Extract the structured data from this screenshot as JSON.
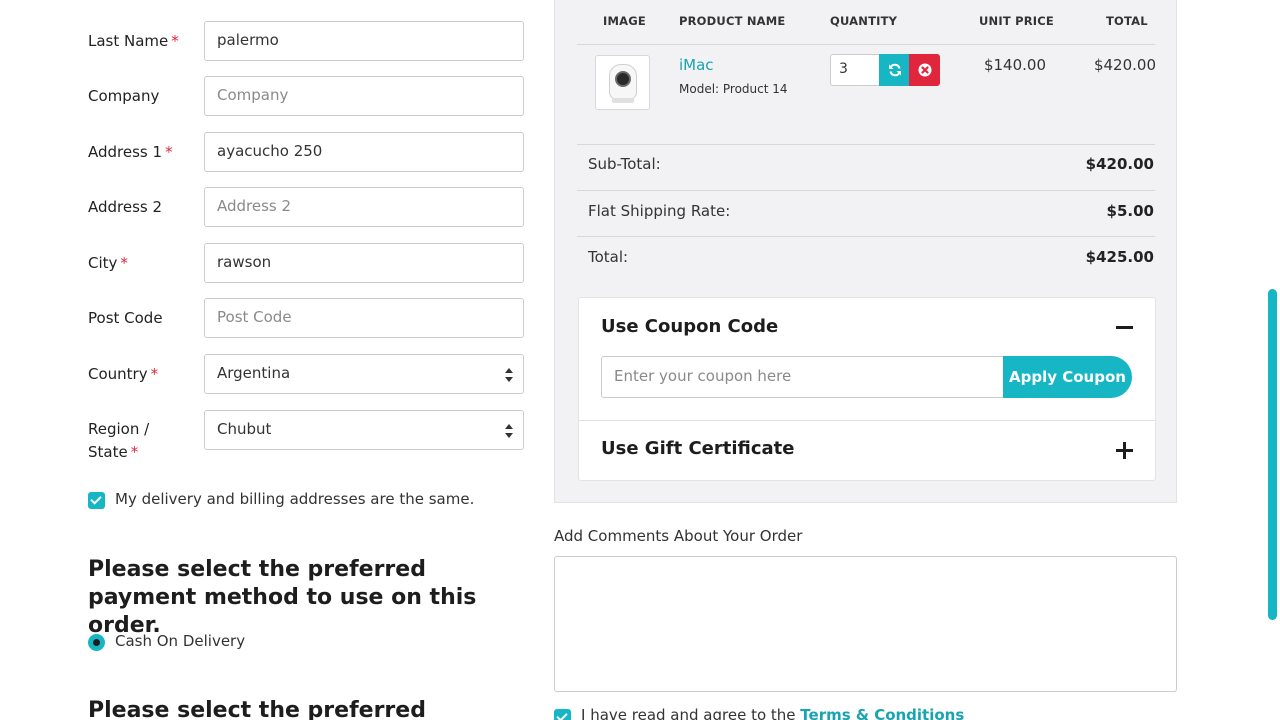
{
  "form": {
    "fields": [
      {
        "label": "Last Name",
        "required": "*",
        "value": "palermo",
        "placeholder": ""
      },
      {
        "label": "Company",
        "required": "",
        "value": "",
        "placeholder": "Company"
      },
      {
        "label": "Address 1",
        "required": "*",
        "value": "ayacucho 250",
        "placeholder": ""
      },
      {
        "label": "Address 2",
        "required": "",
        "value": "",
        "placeholder": "Address 2"
      },
      {
        "label": "City",
        "required": "*",
        "value": "rawson",
        "placeholder": ""
      },
      {
        "label": "Post Code",
        "required": "",
        "value": "",
        "placeholder": "Post Code"
      }
    ],
    "country": {
      "label": "Country",
      "required": "*",
      "selected": "Argentina"
    },
    "region": {
      "label_line1": "Region /",
      "label_line2": "State",
      "required": "*",
      "selected": "Chubut"
    },
    "same_address": {
      "label": "My delivery and billing addresses are the same.",
      "checked": true
    }
  },
  "payment": {
    "heading": "Please select the preferred payment method to use on this order.",
    "option": "Cash On Delivery"
  },
  "shipping": {
    "heading": "Please select the preferred shipping"
  },
  "cart": {
    "headers": {
      "image": "IMAGE",
      "name": "PRODUCT NAME",
      "quantity": "QUANTITY",
      "unit_price": "UNIT PRICE",
      "total": "TOTAL"
    },
    "item": {
      "name": "iMac",
      "model": "Model: Product 14",
      "quantity": "3",
      "unit_price": "$140.00",
      "total": "$420.00",
      "image_icon": "webcam-product-image"
    },
    "totals": [
      {
        "label": "Sub-Total:",
        "value": "$420.00"
      },
      {
        "label": "Flat Shipping Rate:",
        "value": "$5.00"
      },
      {
        "label": "Total:",
        "value": "$425.00"
      }
    ],
    "coupon": {
      "title": "Use Coupon Code",
      "placeholder": "Enter your coupon here",
      "button": "Apply Coupon"
    },
    "gift": {
      "title": "Use Gift Certificate"
    }
  },
  "comments": {
    "label": "Add Comments About Your Order",
    "value": ""
  },
  "terms": {
    "prefix": "I have read and agree to the ",
    "link": "Terms & Conditions",
    "checked": true
  },
  "colors": {
    "accent": "#16b6c5",
    "danger": "#e0263d",
    "link": "#1aa3b0"
  }
}
